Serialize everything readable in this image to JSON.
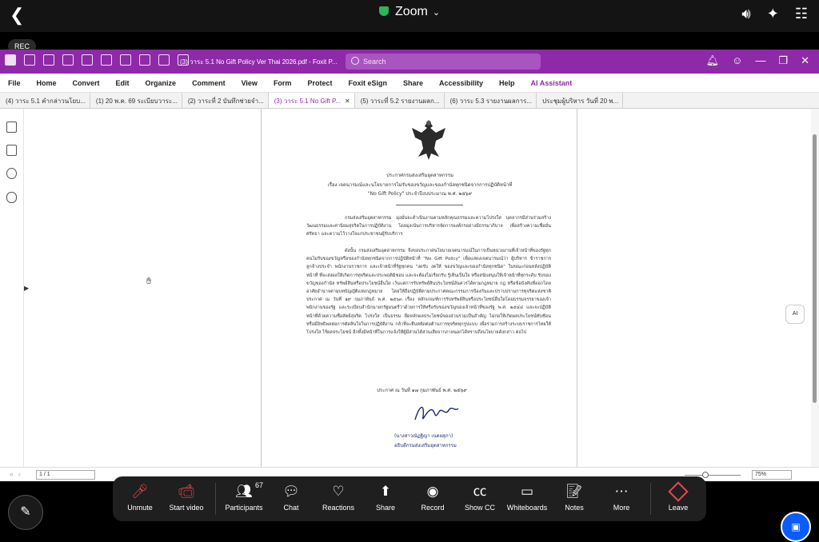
{
  "zoom": {
    "title": "Zoom",
    "rec_label": "REC"
  },
  "foxit": {
    "document_title": "(3) วาระ 5.1 No Gift Policy Ver Thai 2026.pdf - Foxit P...",
    "search_placeholder": "Search",
    "menu": [
      "File",
      "Home",
      "Convert",
      "Edit",
      "Organize",
      "Comment",
      "View",
      "Form",
      "Protect",
      "Foxit eSign",
      "Share",
      "Accessibility",
      "Help",
      "AI Assistant"
    ],
    "tabs": [
      {
        "label": "(4) วาระ 5.1 คำกล่าวนโยบ...",
        "active": false
      },
      {
        "label": "(1) 20 พ.ค. 69 ระเบียบวาระ...",
        "active": false
      },
      {
        "label": "(2) วาระที่ 2 บันทึกช่วยจำ...",
        "active": false
      },
      {
        "label": "(3) วาระ 5.1 No Gift P...",
        "active": true
      },
      {
        "label": "(5) วาระที่ 5.2 รายงานผลก...",
        "active": false
      },
      {
        "label": "(6) วาระ 5.3 รายงานผลการ...",
        "active": false
      },
      {
        "label": "ประชุมผู้บริหาร วันที่ 20 พ...",
        "active": false
      }
    ],
    "page_indicator": "1 / 1",
    "zoom_level": "75%",
    "headset_label": "AI"
  },
  "document": {
    "heading1": "ประกาศกรมส่งเสริมอุตสาหกรรม",
    "heading2": "เรื่อง เจตนารมณ์และนโยบายการไม่รับของขวัญและของกำนัลทุกชนิดจากการปฏิบัติหน้าที่",
    "heading3": "\"No Gift Policy\" ประจำปีงบประมาณ พ.ศ. ๒๕๖๙",
    "para1": "กรมส่งเสริมอุตสาหกรรม มุ่งมั่นจะดำเนินงานตามหลักคุณธรรมและความโปร่งใส บุคลากรมีส่วนร่วมสร้างวัฒนธรรมและค่านิยมสุจริตในการปฏิบัติงาน โดยมุ่งเน้นการบริหารจัดการองค์กรอย่างมีธรรมาภิบาล เพื่อสร้างความเชื่อมั่นศรัทธา และความไว้วางใจแก่ประชาชนผู้รับบริการ",
    "para2": "ดังนั้น กรมส่งเสริมอุตสาหกรรม จึงขอประกาศนโยบายเจตนารมณ์ในการเป็นหน่วยงานที่เจ้าหน้าที่ของรัฐทุกคนไม่รับของขวัญหรือของกำนัลทุกชนิดจากการปฏิบัติหน้าที่ \"No Gift Policy\" เพื่อแสดงเจตนารมณ์ว่า ผู้บริหาร ข้าราชการ ลูกจ้างประจำ พนักงานราชการ และเจ้าหน้าที่รัฐทุกคน \"งดรับ งดให้ ของขวัญและของกำนัลทุกชนิด\" ในขณะก่อนหลังปฏิบัติหน้าที่ ที่จะส่งผลให้เกิดการทุจริตและประพฤติมิชอบ และจะต้องไม่เรียกรับ รู้เห็นเป็นใจ หรือสนับสนุนให้เจ้าหน้าที่ทุกระดับ รับของขวัญของกำนัล ทรัพย์สินหรือประโยชน์อื่นใด เว้นแต่การรับทรัพย์สินประโยชน์อันควรได้ตามกฎหมาย กฎ หรือข้อบังคับที่ออกโดยอาศัยอำนาจตามบทบัญญัติแห่งกฎหมาย โดยให้ถือปฏิบัติตามประกาศคณะกรรมการป้องกันและปราบปรามการทุจริตแห่งชาติ ประกาศ ณ วันที่ ๑๙ กุมภาพันธ์ พ.ศ. ๒๕๖๓ เรื่อง หลักเกณฑ์การรับทรัพย์สินหรือประโยชน์อื่นใดโดยธรรมจรรยาของเจ้าพนักงานของรัฐ และระเบียบสำนักนายกรัฐมนตรีว่าด้วยการให้หรือรับของขวัญของเจ้าหน้าที่ของรัฐ พ.ศ. ๒๕๔๔ และจะปฏิบัติหน้าที่ด้วยความซื่อสัตย์สุจริต โปร่งใส เป็นธรรม ยึดหลักผลประโยชน์ของส่วนรวมเป็นสำคัญ ไม่ก่อให้เกิดผลประโยชน์ทับซ้อน หรือมีอิทธิพลต่อการตัดสินใจในการปฏิบัติงาน กล้าที่จะยืนหยัดต่อต้านการทุจริตทุกรูปแบบ เพื่อร่วมการสร้างระบบราชการไทยให้โปร่งใส ไร้ผลประโยชน์ อีกทั้งมีหน้าที่ในการแจ้งให้ผู้มีส่วนได้ส่วนเสียจากภายนอกได้ทราบถึงนโยบายดังกล่าว ต่อไป",
    "date_line": "ประกาศ ณ วันที่ ๑๗ กุมภาพันธ์ พ.ศ. ๒๕๖๙",
    "signer_name": "(นางสาวณัฏฐิญา เนตยสุภา)",
    "signer_title": "อธิบดีกรมส่งเสริมอุตสาหกรรม"
  },
  "controls": {
    "participant_count": "67",
    "buttons": [
      "Unmute",
      "Start video",
      "Participants",
      "Chat",
      "Reactions",
      "Share",
      "Record",
      "Show CC",
      "Whiteboards",
      "Notes",
      "More",
      "Leave"
    ]
  },
  "colors": {
    "foxit_purple": "#8e2aa8",
    "leave_red": "#e5484d",
    "zoom_blue": "#0b5cff",
    "secure_green": "#2fb45a"
  }
}
